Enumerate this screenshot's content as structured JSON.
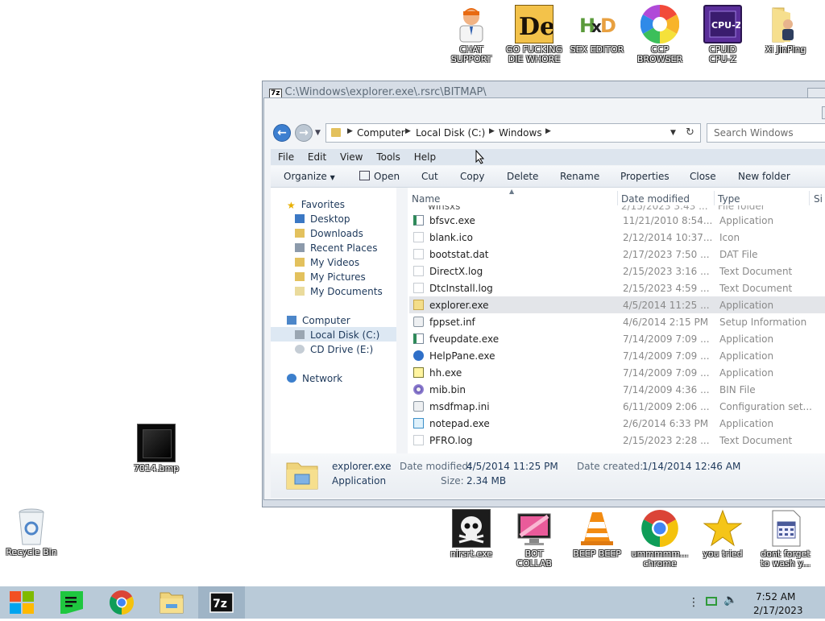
{
  "desktop": {
    "top_icons": [
      {
        "label": "CHAT\nSUPPORT",
        "icon": "doctor-person-icon"
      },
      {
        "label": "GO FUCKING\nDIE WHORE",
        "icon": "de-letters-icon"
      },
      {
        "label": "SEX EDITOR",
        "icon": "hxd-editor-icon"
      },
      {
        "label": "CCP\nBROWSER",
        "icon": "colorful-swirl-icon"
      },
      {
        "label": "CPUID\nCPU-Z",
        "icon": "cpu-z-icon"
      },
      {
        "label": "Xi JinPing",
        "icon": "folder-user-icon"
      }
    ],
    "left_icons": [
      {
        "label": "7014.bmp",
        "icon": "black-image-icon"
      },
      {
        "label": "Recycle Bin",
        "icon": "recycle-bin-icon"
      }
    ],
    "bottom_icons": [
      {
        "label": "nirsrt.exe",
        "icon": "skull-icon"
      },
      {
        "label": "BOT\nCOLLAB",
        "icon": "pink-monitor-icon"
      },
      {
        "label": "BEEP BEEP",
        "icon": "vlc-cone-icon"
      },
      {
        "label": "ummmmm...\nchrome",
        "icon": "chrome-icon"
      },
      {
        "label": "you tried",
        "icon": "gold-star-icon"
      },
      {
        "label": "dont forget\nto wash y...",
        "icon": "calendar-document-icon"
      }
    ]
  },
  "outer_window": {
    "badge": "7z",
    "title": "C:\\Windows\\explorer.exe\\.rsrc\\BITMAP\\"
  },
  "explorer": {
    "breadcrumb": [
      "Computer",
      "Local Disk (C:)",
      "Windows"
    ],
    "search_placeholder": "Search Windows",
    "menu": [
      "File",
      "Edit",
      "View",
      "Tools",
      "Help"
    ],
    "commands": {
      "organize": "Organize",
      "open": "Open",
      "cut": "Cut",
      "copy": "Copy",
      "delete": "Delete",
      "rename": "Rename",
      "properties": "Properties",
      "close": "Close",
      "new_folder": "New folder"
    },
    "nav": {
      "favorites": "Favorites",
      "desktop": "Desktop",
      "downloads": "Downloads",
      "recent_places": "Recent Places",
      "my_videos": "My Videos",
      "my_pictures": "My Pictures",
      "my_documents": "My Documents",
      "computer": "Computer",
      "local_disk": "Local Disk (C:)",
      "cd_drive": "CD Drive (E:)",
      "network": "Network"
    },
    "columns": {
      "name": "Name",
      "date": "Date modified",
      "type": "Type",
      "size": "Si"
    },
    "partial_row": {
      "name": "winsxs",
      "date": "2/15/2023 3:43 ...",
      "type": "File folder"
    },
    "files": [
      {
        "name": "bfsvc.exe",
        "date": "11/21/2010 8:54...",
        "type": "Application",
        "icon": "exe-icon"
      },
      {
        "name": "blank.ico",
        "date": "2/12/2014 10:37...",
        "type": "Icon",
        "icon": "blank-file-icon"
      },
      {
        "name": "bootstat.dat",
        "date": "2/17/2023 7:50 ...",
        "type": "DAT File",
        "icon": "blank-file-icon"
      },
      {
        "name": "DirectX.log",
        "date": "2/15/2023 3:16 ...",
        "type": "Text Document",
        "icon": "text-file-icon"
      },
      {
        "name": "DtcInstall.log",
        "date": "2/15/2023 4:59 ...",
        "type": "Text Document",
        "icon": "text-file-icon"
      },
      {
        "name": "explorer.exe",
        "date": "4/5/2014 11:25 ...",
        "type": "Application",
        "icon": "folder-exe-icon"
      },
      {
        "name": "fppset.inf",
        "date": "4/6/2014 2:15 PM",
        "type": "Setup Information",
        "icon": "gear-file-icon"
      },
      {
        "name": "fveupdate.exe",
        "date": "7/14/2009 7:09 ...",
        "type": "Application",
        "icon": "exe-icon"
      },
      {
        "name": "HelpPane.exe",
        "date": "7/14/2009 7:09 ...",
        "type": "Application",
        "icon": "help-icon"
      },
      {
        "name": "hh.exe",
        "date": "7/14/2009 7:09 ...",
        "type": "Application",
        "icon": "help-document-icon"
      },
      {
        "name": "mib.bin",
        "date": "7/14/2009 4:36 ...",
        "type": "BIN File",
        "icon": "disc-icon"
      },
      {
        "name": "msdfmap.ini",
        "date": "6/11/2009 2:06 ...",
        "type": "Configuration set...",
        "icon": "gear-file-icon"
      },
      {
        "name": "notepad.exe",
        "date": "2/6/2014 6:33 PM",
        "type": "Application",
        "icon": "notepad-icon"
      },
      {
        "name": "PFRO.log",
        "date": "2/15/2023 2:28 ...",
        "type": "Text Document",
        "icon": "text-file-icon"
      }
    ],
    "selected_file": "explorer.exe",
    "details": {
      "name": "explorer.exe",
      "type": "Application",
      "modified_label": "Date modified:",
      "modified": "4/5/2014 11:25 PM",
      "created_label": "Date created:",
      "created": "1/14/2014 12:46 AM",
      "size_label": "Size:",
      "size": "2.34 MB"
    }
  },
  "taskbar": {
    "apps": [
      "start-icon",
      "notes-app-icon",
      "chrome-icon",
      "file-explorer-icon",
      "7zip-icon"
    ],
    "active_app": "7zip-icon",
    "time": "7:52 AM",
    "date": "2/17/2023"
  },
  "colors": {
    "taskbar": "#b9cad8",
    "selection": "#e3e5e9",
    "accent_blue": "#3d7fd0"
  }
}
